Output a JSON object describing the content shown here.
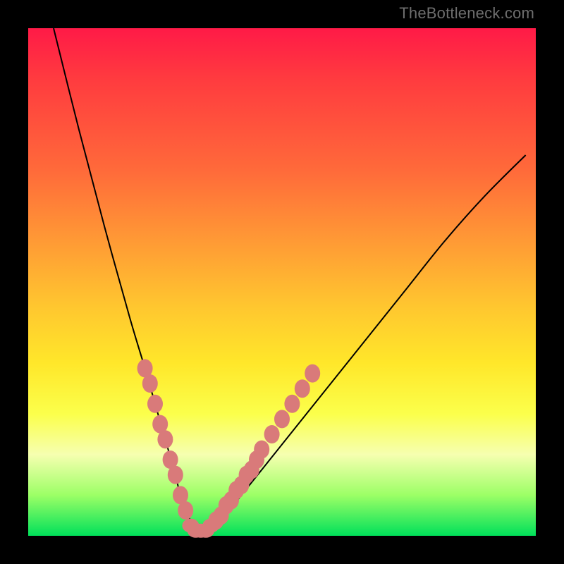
{
  "watermark": "TheBottleneck.com",
  "colors": {
    "frame": "#000000",
    "curve": "#000000",
    "marker": "#d97a7a",
    "gradient_stops": [
      "#ff1a47",
      "#ff3b3f",
      "#ff6a3a",
      "#ff9a35",
      "#ffc72f",
      "#ffe72a",
      "#fbff4b",
      "#f6ffb0",
      "#9cff66",
      "#00e05a"
    ]
  },
  "chart_data": {
    "type": "line",
    "title": "",
    "xlabel": "",
    "ylabel": "",
    "xlim": [
      0,
      100
    ],
    "ylim": [
      0,
      100
    ],
    "curve": {
      "x": [
        5,
        10,
        15,
        20,
        23,
        25,
        27,
        29,
        30,
        32,
        34,
        35,
        38,
        42,
        50,
        58,
        66,
        74,
        82,
        90,
        98
      ],
      "y": [
        100,
        80,
        61,
        43,
        33,
        26,
        19,
        12,
        8,
        3,
        1,
        1,
        3,
        8,
        18,
        28,
        38,
        48,
        58,
        67,
        75
      ]
    },
    "markers_left": [
      {
        "x": 23,
        "y": 33
      },
      {
        "x": 24,
        "y": 30
      },
      {
        "x": 25,
        "y": 26
      },
      {
        "x": 26,
        "y": 22
      },
      {
        "x": 27,
        "y": 19
      },
      {
        "x": 28,
        "y": 15
      },
      {
        "x": 29,
        "y": 12
      },
      {
        "x": 30,
        "y": 8
      },
      {
        "x": 31,
        "y": 5
      }
    ],
    "markers_right": [
      {
        "x": 37,
        "y": 3
      },
      {
        "x": 38,
        "y": 4
      },
      {
        "x": 39,
        "y": 6
      },
      {
        "x": 40,
        "y": 7
      },
      {
        "x": 41,
        "y": 9
      },
      {
        "x": 42,
        "y": 10
      },
      {
        "x": 43,
        "y": 12
      },
      {
        "x": 44,
        "y": 13
      },
      {
        "x": 45,
        "y": 15
      },
      {
        "x": 46,
        "y": 17
      },
      {
        "x": 48,
        "y": 20
      },
      {
        "x": 50,
        "y": 23
      },
      {
        "x": 52,
        "y": 26
      },
      {
        "x": 54,
        "y": 29
      },
      {
        "x": 56,
        "y": 32
      }
    ],
    "markers_bottom": [
      {
        "x": 32,
        "y": 2
      },
      {
        "x": 33,
        "y": 1
      },
      {
        "x": 34,
        "y": 1
      },
      {
        "x": 35,
        "y": 1
      },
      {
        "x": 36,
        "y": 2
      }
    ]
  }
}
